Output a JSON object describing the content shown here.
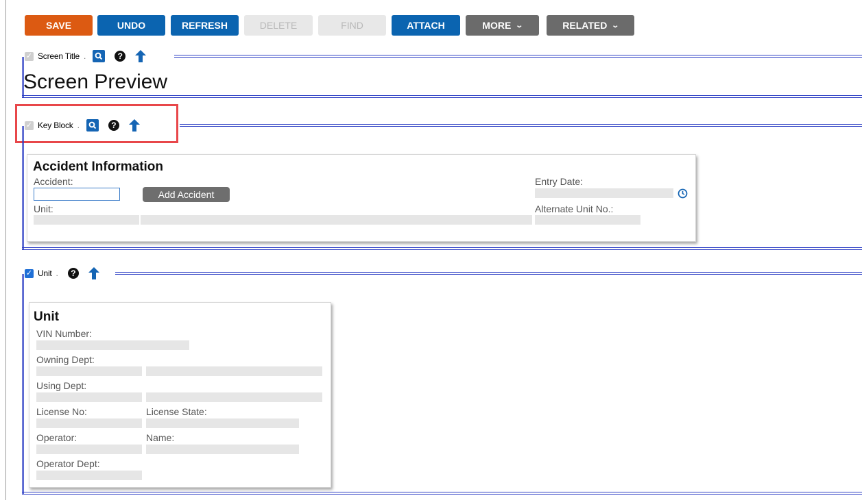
{
  "toolbar": {
    "save": "SAVE",
    "undo": "UNDO",
    "refresh": "REFRESH",
    "delete": "DELETE",
    "find": "FIND",
    "attach": "ATTACH",
    "more": "MORE",
    "related": "RELATED"
  },
  "sections": {
    "screen_title": {
      "label": "Screen Title",
      "checked": false
    },
    "key_block": {
      "label": "Key Block",
      "checked": false
    },
    "unit": {
      "label": "Unit",
      "checked": true
    }
  },
  "separator": ".",
  "screen_preview": "Screen Preview",
  "accident": {
    "title": "Accident Information",
    "accident_label": "Accident:",
    "add_button": "Add Accident",
    "unit_label": "Unit:",
    "entry_date_label": "Entry Date:",
    "alt_unit_label": "Alternate Unit No.:"
  },
  "unit_card": {
    "title": "Unit",
    "vin_label": "VIN Number:",
    "owning_dept_label": "Owning Dept:",
    "using_dept_label": "Using Dept:",
    "license_no_label": "License No:",
    "license_state_label": "License State:",
    "operator_label": "Operator:",
    "name_label": "Name:",
    "operator_dept_label": "Operator Dept:"
  },
  "colors": {
    "save": "#dc5a12",
    "primary": "#0b64b0",
    "menu_gray": "#6b6b6b",
    "rule_blue": "#2b3dc4",
    "highlight": "#e8474a"
  },
  "icons": [
    "magnifier-icon",
    "help-icon",
    "arrow-up-icon",
    "clock-icon",
    "chevron-down-icon",
    "checkbox-icon"
  ]
}
